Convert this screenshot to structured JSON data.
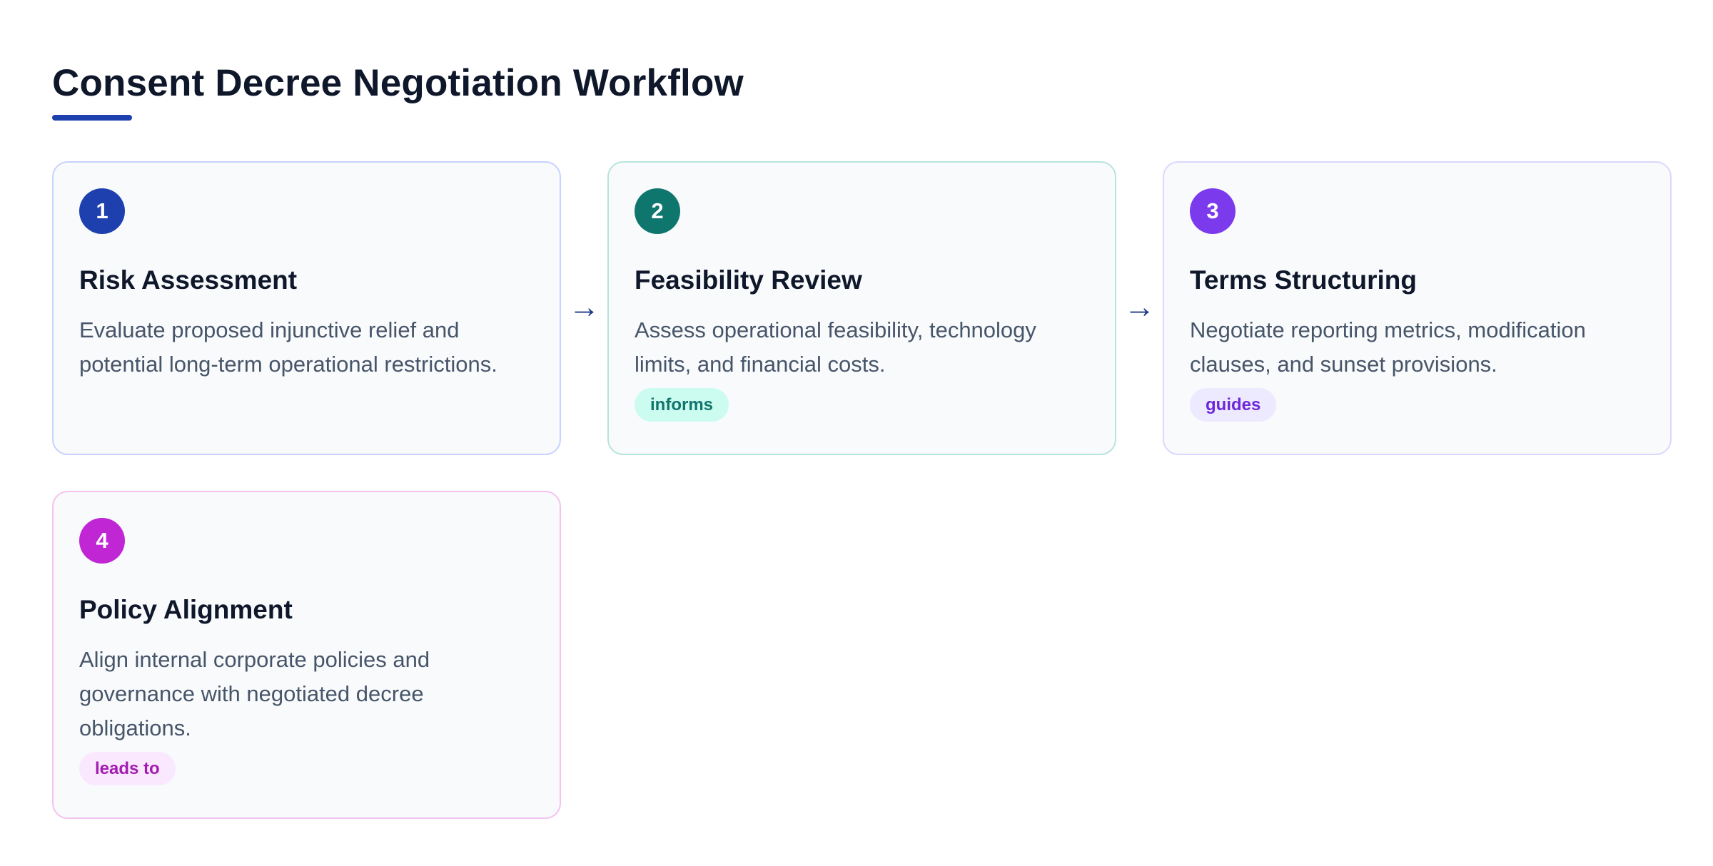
{
  "title": "Consent Decree Negotiation Workflow",
  "colors": {
    "accent": "#1e40af",
    "step1": "#1e40af",
    "step2": "#0f766e",
    "step3": "#7c3aed",
    "step4": "#c026d3"
  },
  "connector_icon": "arrow-right-icon",
  "connector_glyph": "→",
  "steps": [
    {
      "number": "1",
      "title": "Risk Assessment",
      "description": "Evaluate proposed injunctive relief and potential long-term operational restrictions.",
      "tag": ""
    },
    {
      "number": "2",
      "title": "Feasibility Review",
      "description": "Assess operational feasibility, technology limits, and financial costs.",
      "tag": "informs"
    },
    {
      "number": "3",
      "title": "Terms Structuring",
      "description": "Negotiate reporting metrics, modification clauses, and sunset provisions.",
      "tag": "guides"
    },
    {
      "number": "4",
      "title": "Policy Alignment",
      "description": "Align internal corporate policies and governance with negotiated decree obligations.",
      "tag": "leads to"
    }
  ]
}
